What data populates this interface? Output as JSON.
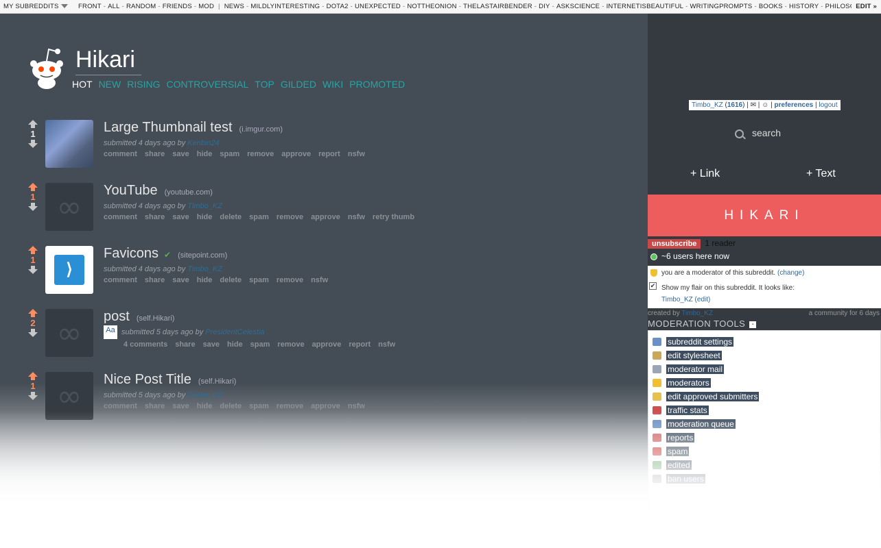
{
  "srbar": {
    "my_subreddits": "MY SUBREDDITS",
    "front_items": [
      "FRONT",
      "ALL",
      "RANDOM",
      "FRIENDS",
      "MOD"
    ],
    "sub_items": [
      "NEWS",
      "MILDLYINTERESTING",
      "DOTA2",
      "UNEXPECTED",
      "NOTTHEONION",
      "THELASTAIRBENDER",
      "DIY",
      "ASKSCIENCE",
      "INTERNETISBEAUTIFUL",
      "WRITINGPROMPTS",
      "BOOKS",
      "HISTORY",
      "PHILOSC"
    ],
    "edit": "EDIT »"
  },
  "header": {
    "subreddit": "Hikari",
    "tabs": [
      "HOT",
      "NEW",
      "RISING",
      "CONTROVERSIAL",
      "TOP",
      "GILDED",
      "WIKI",
      "PROMOTED"
    ],
    "selected_tab": "HOT"
  },
  "posts": [
    {
      "score": "1",
      "title": "Large Thumbnail test",
      "domain": "(i.imgur.com)",
      "age": "submitted 4 days ago by",
      "author": "Kenbin24",
      "buttons": [
        "comment",
        "share",
        "save",
        "hide",
        "spam",
        "remove",
        "approve",
        "report",
        "nsfw"
      ]
    },
    {
      "score": "1",
      "title": "YouTube",
      "domain": "(youtube.com)",
      "age": "submitted 4 days ago by",
      "author": "Timbo_KZ",
      "buttons": [
        "comment",
        "share",
        "save",
        "hide",
        "delete",
        "spam",
        "remove",
        "approve",
        "nsfw",
        "retry thumb"
      ]
    },
    {
      "score": "1",
      "title": "Favicons",
      "domain": "(sitepoint.com)",
      "age": "submitted 4 days ago by",
      "author": "Timbo_KZ",
      "buttons": [
        "comment",
        "share",
        "save",
        "hide",
        "delete",
        "spam",
        "remove",
        "nsfw"
      ]
    },
    {
      "score": "2",
      "title": "post",
      "domain": "(self.Hikari)",
      "age": "submitted 5 days ago by",
      "author": "PresidentCelestia",
      "buttons": [
        "4 comments",
        "share",
        "save",
        "hide",
        "spam",
        "remove",
        "approve",
        "report",
        "nsfw"
      ],
      "flair": "Aa"
    },
    {
      "score": "1",
      "title": "Nice Post Title",
      "domain": "(self.Hikari)",
      "age": "submitted 5 days ago by",
      "author": "Timbo_KZ",
      "buttons": [
        "comment",
        "share",
        "save",
        "hide",
        "delete",
        "spam",
        "remove",
        "approve",
        "nsfw"
      ]
    }
  ],
  "sidebar": {
    "user": "Timbo_KZ",
    "karma": "1616",
    "preferences": "preferences",
    "logout": "logout",
    "search_placeholder": "search",
    "link_button": "+ Link",
    "text_button": "+ Text",
    "banner": "HIKARI",
    "unsubscribe": "unsubscribe",
    "readers": "1 reader",
    "online": "~6 users here now",
    "moderator_text": "you are a moderator of this subreddit.",
    "change": "(change)",
    "flair_text": "Show my flair on this subreddit. It looks like:",
    "flair_user": "Timbo_KZ",
    "flair_edit": "(edit)",
    "created_by": "created by",
    "creator": "Timbo_KZ",
    "community_age": "a community for 6 days",
    "mod_tools_title": "MODERATION TOOLS",
    "mod_tools": [
      {
        "label": "subreddit settings",
        "icon": "settings-icon",
        "color": "#6b8fc7"
      },
      {
        "label": "edit stylesheet",
        "icon": "stylesheet-icon",
        "color": "#c9a85a"
      },
      {
        "label": "moderator mail",
        "icon": "mail-icon",
        "color": "#9aa5b5"
      },
      {
        "label": "moderators",
        "icon": "shield-icon",
        "color": "#f0c030"
      },
      {
        "label": "edit approved submitters",
        "icon": "pencil-icon",
        "color": "#e8c050"
      },
      {
        "label": "traffic stats",
        "icon": "chart-icon",
        "color": "#d05050"
      },
      {
        "label": "moderation queue",
        "icon": "queue-icon",
        "color": "#6a8fc5"
      },
      {
        "label": "reports",
        "icon": "flag-icon",
        "color": "#d06060"
      },
      {
        "label": "spam",
        "icon": "spam-icon",
        "color": "#d04040"
      },
      {
        "label": "edited",
        "icon": "edited-icon",
        "color": "#60a060"
      },
      {
        "label": "ban users",
        "icon": "ban-icon",
        "color": "#888888"
      }
    ]
  }
}
